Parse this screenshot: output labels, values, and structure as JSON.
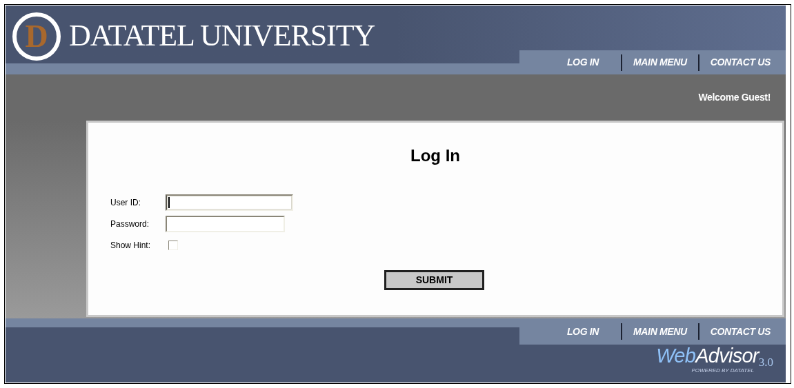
{
  "header": {
    "title": "DATATEL UNIVERSITY",
    "logo_letter": "D",
    "nav": [
      "LOG IN",
      "MAIN MENU",
      "CONTACT US"
    ]
  },
  "welcome": "Welcome Guest!",
  "form": {
    "title": "Log In",
    "fields": [
      {
        "kind": "text",
        "label": "User ID:",
        "focused": true
      },
      {
        "kind": "password",
        "label": "Password:",
        "focused": false
      },
      {
        "kind": "checkbox",
        "label": "Show Hint:",
        "checked": false
      }
    ],
    "submit": "SUBMIT"
  },
  "footer": {
    "nav": [
      "LOG IN",
      "MAIN MENU",
      "CONTACT US"
    ],
    "logo": {
      "web": "Web",
      "advisor": "Advisor",
      "version": "3.0",
      "tagline": "POWERED BY DATATEL"
    }
  }
}
